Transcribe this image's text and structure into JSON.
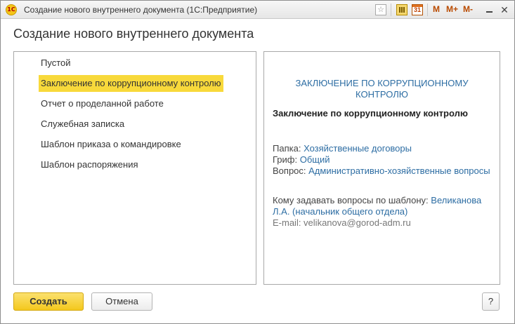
{
  "window": {
    "title": "Создание нового внутреннего документа  (1С:Предприятие)",
    "app_icon_text": "1С",
    "toolbar": {
      "star_icon": "☆",
      "calendar_day": "31",
      "m_label": "M",
      "m_plus_label": "M+",
      "m_minus_label": "M-",
      "close_glyph": "✕"
    }
  },
  "heading": "Создание нового внутреннего документа",
  "templates": [
    {
      "label": "Пустой",
      "selected": false
    },
    {
      "label": "Заключение по коррупционному контролю",
      "selected": true
    },
    {
      "label": "Отчет о проделанной работе",
      "selected": false
    },
    {
      "label": "Служебная записка",
      "selected": false
    },
    {
      "label": "Шаблон приказа о командировке",
      "selected": false
    },
    {
      "label": "Шаблон распоряжения",
      "selected": false
    }
  ],
  "preview": {
    "header": "ЗАКЛЮЧЕНИЕ ПО КОРРУПЦИОННОМУ КОНТРОЛЮ",
    "doc_name": "Заключение по коррупционному контролю",
    "folder_label": "Папка:",
    "folder_value": "Хозяйственные договоры",
    "grif_label": "Гриф:",
    "grif_value": "Общий",
    "question_label": "Вопрос:",
    "question_value": "Административно-хозяйственные вопросы",
    "contact_label": "Кому задавать вопросы по шаблону:",
    "contact_value": "Великанова Л.А. (начальник общего отдела)",
    "email": "E-mail: velikanova@gorod-adm.ru"
  },
  "buttons": {
    "create": "Создать",
    "cancel": "Отмена",
    "help": "?"
  },
  "colors": {
    "selection": "#f8d93b",
    "primary_button": "#f4c81d",
    "link": "#2d6da3"
  }
}
